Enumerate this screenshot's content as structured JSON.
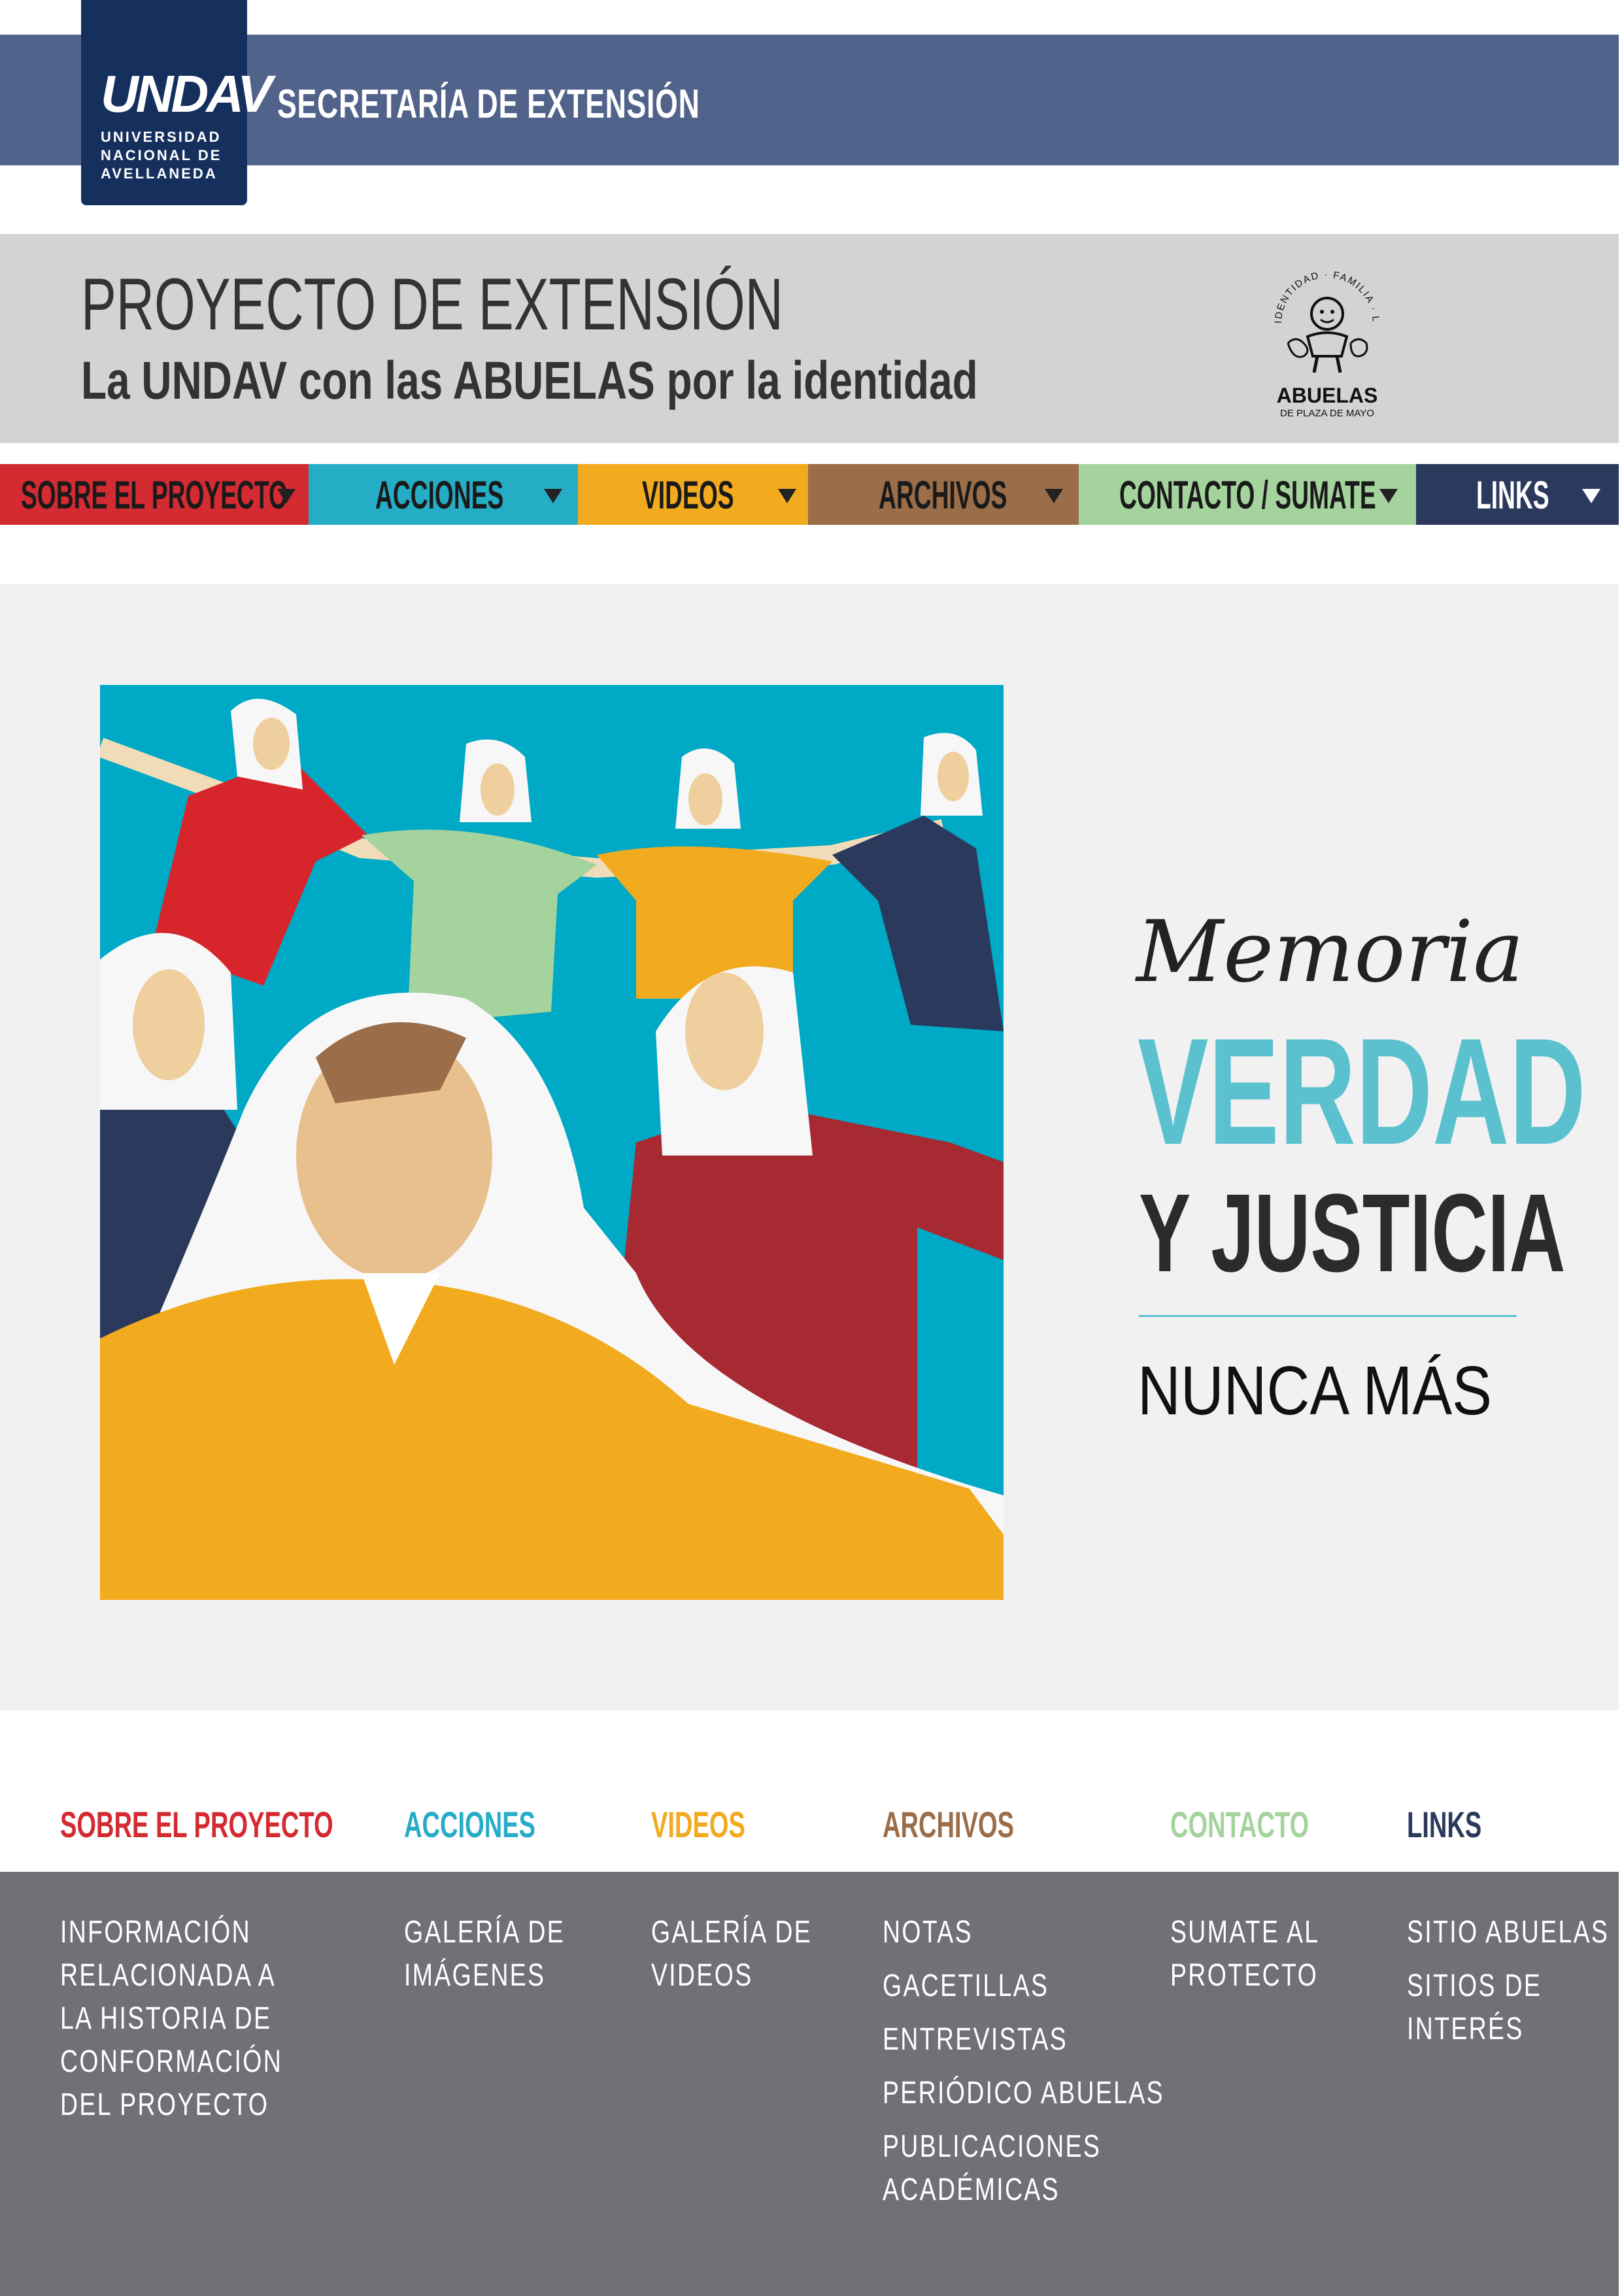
{
  "header": {
    "logo_mark": "UNDAV",
    "logo_sub": "UNIVERSIDAD NACIONAL DE AVELLANEDA",
    "secretaria": "SECRETARÍA DE EXTENSIÓN",
    "brand_color": "#52638b"
  },
  "project": {
    "title": "PROYECTO DE EXTENSIÓN",
    "subtitle": "La UNDAV con las ABUELAS por la identidad",
    "partner_logo": {
      "arc_text": "IDENTIDAD · FAMILIA · LIBERTAD",
      "name": "ABUELAS",
      "place": "DE PLAZA DE MAYO"
    }
  },
  "nav": {
    "items": [
      {
        "label": "SOBRE EL PROYECTO",
        "color": "#d42a31"
      },
      {
        "label": "ACCIONES",
        "color": "#26adc6"
      },
      {
        "label": "VIDEOS",
        "color": "#f2aa1e"
      },
      {
        "label": "ARCHIVOS",
        "color": "#9b6d48"
      },
      {
        "label": "CONTACTO / SUMATE",
        "color": "#a4d39d"
      },
      {
        "label": "LINKS",
        "color": "#2b3a5c"
      }
    ]
  },
  "hero": {
    "memoria": "Memoria",
    "verdad": "VERDAD",
    "justicia": "Y JUSTICIA",
    "nunca": "NUNCA MÁS",
    "accent_color": "#5bc1cf"
  },
  "footer": {
    "columns": [
      {
        "heading": "SOBRE EL PROYECTO",
        "color": "#d42a31",
        "links": [
          "INFORMACIÓN",
          "RELACIONADA A",
          "LA HISTORIA DE",
          "CONFORMACIÓN",
          "DEL PROYECTO"
        ]
      },
      {
        "heading": "ACCIONES",
        "color": "#26adc6",
        "links": [
          "GALERÍA DE",
          "IMÁGENES"
        ]
      },
      {
        "heading": "VIDEOS",
        "color": "#f2aa1e",
        "links": [
          "GALERÍA DE",
          "VIDEOS"
        ]
      },
      {
        "heading": "ARCHIVOS",
        "color": "#9b6d48",
        "links": [
          "NOTAS",
          "GACETILLAS",
          "ENTREVISTAS",
          "PERIÓDICO ABUELAS",
          "PUBLICACIONES",
          "ACADÉMICAS"
        ]
      },
      {
        "heading": "CONTACTO",
        "color": "#a4d39d",
        "links": [
          "SUMATE AL",
          "PROTECTO"
        ]
      },
      {
        "heading": "LINKS",
        "color": "#2b3a5c",
        "links": [
          "SITIO ABUELAS",
          "SITIOS DE",
          "INTERÉS"
        ]
      }
    ]
  }
}
